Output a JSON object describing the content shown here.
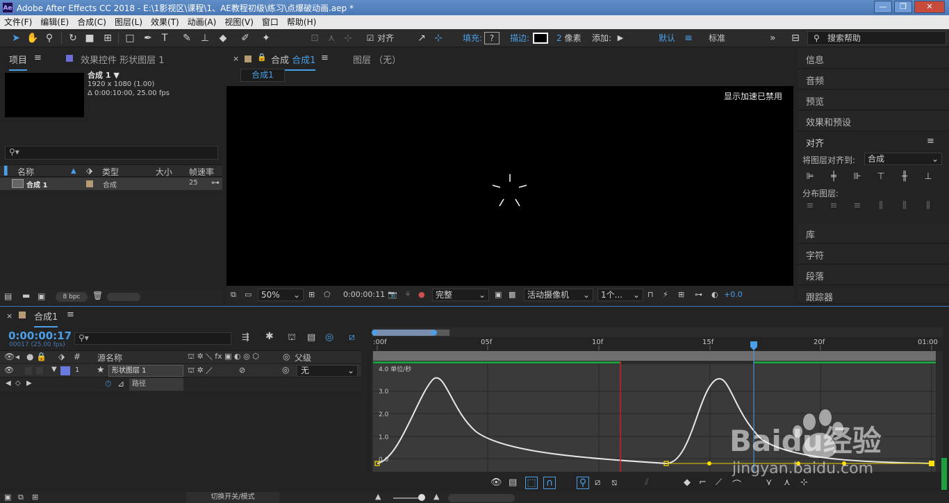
{
  "window": {
    "app_badge": "Ae",
    "title": "Adobe After Effects CC 2018 - E:\\1影视区\\课程\\1、AE教程初级\\练习\\点爆破动画.aep *",
    "minimize": "—",
    "maximize": "❐",
    "close": "✕"
  },
  "menu": [
    "文件(F)",
    "编辑(E)",
    "合成(C)",
    "图层(L)",
    "效果(T)",
    "动画(A)",
    "视图(V)",
    "窗口",
    "帮助(H)"
  ],
  "toolbar": {
    "align_label": "对齐",
    "fill_label": "填充:",
    "fill_value": "?",
    "stroke_label": "描边:",
    "stroke_width": "2 像素",
    "add_label": "添加:",
    "workspace_default": "默认",
    "workspace_standard": "标准",
    "more": "»",
    "search_help": "搜索帮助"
  },
  "project_panel": {
    "tab_project": "项目",
    "tab_effects": "效果控件 形状图层 1",
    "comp_name": "合成 1 ▼",
    "comp_res": "1920 x 1080 (1.00)",
    "comp_dur": "Δ 0:00:10:00, 25.00 fps",
    "columns": {
      "name": "名称",
      "type": "类型",
      "size": "大小",
      "fps": "帧速率"
    },
    "row": {
      "name": "合成 1",
      "type": "合成",
      "fps": "25"
    },
    "bpc": "8 bpc"
  },
  "viewer": {
    "tab_close": "×",
    "tab_label": "合成",
    "tab_comp": "合成1",
    "tab_layer": "图层 （无）",
    "subtab": "合成1",
    "gpu_notice": "显示加速已禁用",
    "zoom": "50%",
    "timecode": "0:00:00:11",
    "quality": "完整",
    "camera": "活动摄像机",
    "views": "1个...",
    "exposure": "+0.0"
  },
  "right_panel": {
    "items": [
      "信息",
      "音频",
      "预览",
      "效果和预设",
      "对齐"
    ],
    "align_to_label": "将图层对齐到:",
    "align_to_value": "合成",
    "distribute_label": "分布图层:",
    "bottom_items": [
      "库",
      "字符",
      "段落",
      "跟踪器"
    ]
  },
  "timeline": {
    "tab_close": "×",
    "tab_label": "合成1",
    "timecode": "0:00:00:17",
    "frame_info": "00017 (25.00 fps)",
    "columns": {
      "num": "#",
      "source": "源名称",
      "parent": "父级"
    },
    "layer": {
      "num": "1",
      "name": "形状图层 1",
      "parent": "无"
    },
    "property": "路径",
    "ruler": [
      ":00f",
      "05f",
      "10f",
      "15f",
      "20f",
      "01:00"
    ],
    "graph_labels": [
      "4.0 单位/秒",
      "3.0",
      "2.0",
      "1.0",
      "0.0"
    ],
    "bottom_toggle": "切换开关/模式"
  },
  "watermark": {
    "brand": "Baidu经验",
    "url": "jingyan.baidu.com"
  },
  "colors": {
    "accent": "#4a9fe8",
    "curve": "#e8e8e8",
    "keyframe": "#ffe000",
    "red_marker": "#d02020",
    "work_area_green": "#1fa040"
  }
}
